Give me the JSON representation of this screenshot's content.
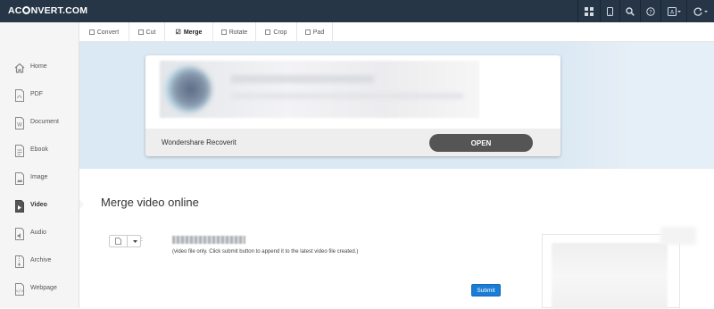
{
  "header": {
    "logo_prefix": "AC",
    "logo_suffix": "NVERT.COM",
    "icons": [
      "grid-icon",
      "mobile-icon",
      "search-icon",
      "help-icon",
      "language-icon",
      "refresh-icon"
    ]
  },
  "sidebar": {
    "items": [
      {
        "label": "Home",
        "icon": "home-icon"
      },
      {
        "label": "PDF",
        "icon": "pdf-icon"
      },
      {
        "label": "Document",
        "icon": "document-icon"
      },
      {
        "label": "Ebook",
        "icon": "ebook-icon"
      },
      {
        "label": "Image",
        "icon": "image-icon"
      },
      {
        "label": "Video",
        "icon": "video-icon",
        "active": true
      },
      {
        "label": "Audio",
        "icon": "audio-icon"
      },
      {
        "label": "Archive",
        "icon": "archive-icon"
      },
      {
        "label": "Webpage",
        "icon": "webpage-icon"
      }
    ]
  },
  "tabs": [
    {
      "label": "Convert"
    },
    {
      "label": "Cut"
    },
    {
      "label": "Merge",
      "active": true
    },
    {
      "label": "Rotate"
    },
    {
      "label": "Crop"
    },
    {
      "label": "Pad"
    }
  ],
  "ad": {
    "brand": "Wondershare Recoverit",
    "button": "OPEN"
  },
  "main": {
    "title": "Merge video online",
    "colon": ":",
    "hint": "(video file only. Click submit button to append it to the latest video file created.)",
    "submit": "Submit"
  },
  "colors": {
    "topbar": "#263646",
    "accent": "#1a7dd6",
    "adband": "#dbe9f4"
  }
}
